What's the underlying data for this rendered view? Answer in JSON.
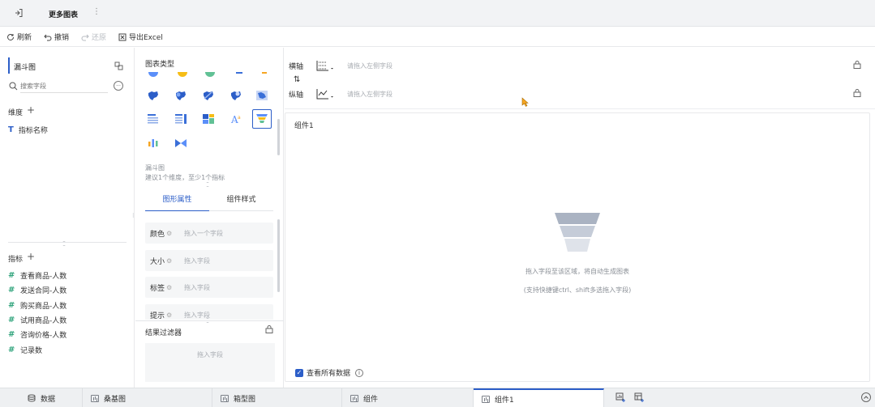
{
  "titlebar": {
    "title": "更多图表"
  },
  "toolbar": {
    "refresh": "刷新",
    "undo": "撤销",
    "redo": "还原",
    "export": "导出Excel"
  },
  "left": {
    "dataset_name": "漏斗图",
    "search_placeholder": "搜索字段",
    "dimensions_label": "维度",
    "dimensions": [
      "指标名称"
    ],
    "measures_label": "指标",
    "measures": [
      "查看商品-人数",
      "发送合同-人数",
      "购买商品-人数",
      "试用商品-人数",
      "咨询价格-人数",
      "记录数"
    ]
  },
  "mid": {
    "chart_types_label": "图表类型",
    "selected_chart_name": "漏斗图",
    "selected_chart_hint": "建议1个维度，至少1个指标",
    "tabs": [
      "图形属性",
      "组件样式"
    ],
    "props": [
      {
        "label": "颜色",
        "placeholder": "拖入一个字段"
      },
      {
        "label": "大小",
        "placeholder": "拖入字段"
      },
      {
        "label": "标签",
        "placeholder": "拖入字段"
      },
      {
        "label": "提示",
        "placeholder": "拖入字段"
      }
    ],
    "filter_label": "结果过滤器",
    "filter_placeholder": "拖入字段"
  },
  "right": {
    "x_axis_label": "横轴",
    "y_axis_label": "纵轴",
    "axis_placeholder": "请拖入左侧字段",
    "component_title": "组件1",
    "empty_line1": "拖入字段至该区域，将自动生成图表",
    "empty_line2": "(支持快捷键ctrl、shift多选拖入字段)",
    "view_all_label": "查看所有数据"
  },
  "tabs": [
    "数据",
    "桑基图",
    "箱型图",
    "组件",
    "组件1"
  ],
  "colors": {
    "accent": "#2c5ec8",
    "measure": "#2fa37b"
  }
}
